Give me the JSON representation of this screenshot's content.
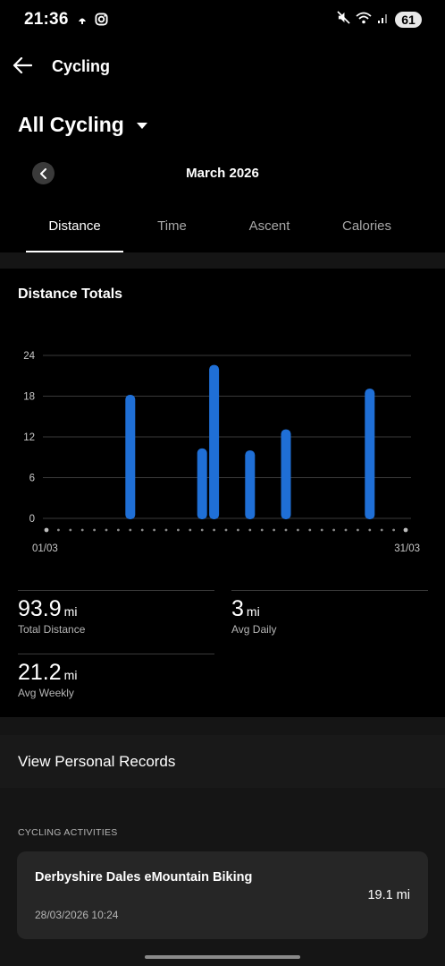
{
  "status_bar": {
    "time": "21:36",
    "battery": "61",
    "icons": [
      "notification-icon",
      "instagram-icon",
      "mute-icon",
      "wifi-icon",
      "signal-icon"
    ]
  },
  "header": {
    "title": "Cycling",
    "back_icon": "arrow-left-icon"
  },
  "filter": {
    "label": "All Cycling"
  },
  "month_nav": {
    "label": "March 2026"
  },
  "tabs": [
    {
      "label": "Distance",
      "active": true
    },
    {
      "label": "Time",
      "active": false
    },
    {
      "label": "Ascent",
      "active": false
    },
    {
      "label": "Calories",
      "active": false
    }
  ],
  "card": {
    "title": "Distance Totals"
  },
  "chart_data": {
    "type": "bar",
    "x_start_label": "01/03",
    "x_end_label": "31/03",
    "days": 31,
    "y_ticks": [
      "0",
      "6",
      "12",
      "18",
      "24"
    ],
    "ylim": [
      0,
      24
    ],
    "grid": true,
    "bar_color": "#1f6fd6",
    "series": [
      {
        "values": [
          {
            "day": 8,
            "value": 18.2
          },
          {
            "day": 14,
            "value": 10.3
          },
          {
            "day": 15,
            "value": 22.6
          },
          {
            "day": 18,
            "value": 10.0
          },
          {
            "day": 21,
            "value": 13.1
          },
          {
            "day": 28,
            "value": 19.1
          }
        ]
      }
    ]
  },
  "stats": [
    {
      "value": "93.9",
      "unit": "mi",
      "label": "Total Distance"
    },
    {
      "value": "3",
      "unit": "mi",
      "label": "Avg Daily"
    },
    {
      "value": "21.2",
      "unit": "mi",
      "label": "Avg Weekly"
    }
  ],
  "personal_records": {
    "label": "View Personal Records"
  },
  "activities": {
    "section_label": "CYCLING ACTIVITIES",
    "items": [
      {
        "name": "Derbyshire Dales eMountain Biking",
        "date": "28/03/2026 10:24",
        "distance": "19.1 mi"
      }
    ]
  }
}
